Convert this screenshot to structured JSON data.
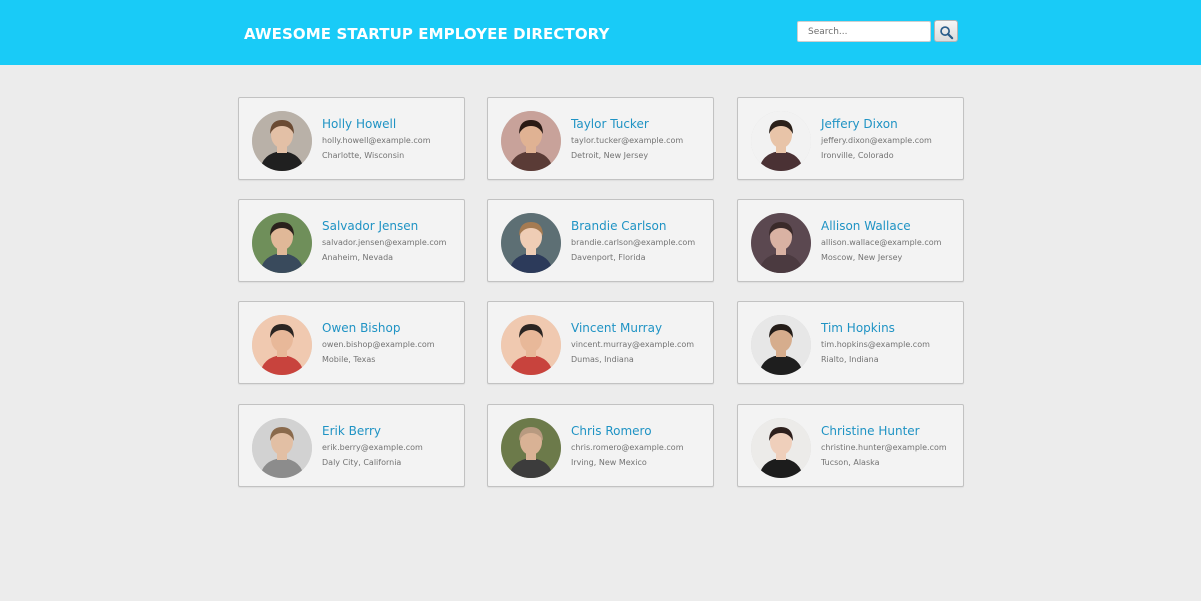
{
  "header": {
    "title": "AWESOME STARTUP EMPLOYEE DIRECTORY",
    "search_placeholder": "Search...",
    "search_button_icon": "search-icon",
    "background_color": "#19cbf7"
  },
  "employees": [
    {
      "name": "Holly Howell",
      "email": "holly.howell@example.com",
      "location": "Charlotte, Wisconsin",
      "photo": {
        "bg": "#b9b1a8",
        "skin": "#e3c0a6",
        "hair": "#6b4b33",
        "shirt": "#202020"
      }
    },
    {
      "name": "Taylor Tucker",
      "email": "taylor.tucker@example.com",
      "location": "Detroit, New Jersey",
      "photo": {
        "bg": "#c8a29a",
        "skin": "#e0b293",
        "hair": "#2a1a14",
        "shirt": "#5a3b36"
      }
    },
    {
      "name": "Jeffery Dixon",
      "email": "jeffery.dixon@example.com",
      "location": "Ironville, Colorado",
      "photo": {
        "bg": "#f2f2f2",
        "skin": "#e8c4a8",
        "hair": "#2b2019",
        "shirt": "#4a3134"
      }
    },
    {
      "name": "Salvador Jensen",
      "email": "salvador.jensen@example.com",
      "location": "Anaheim, Nevada",
      "photo": {
        "bg": "#6f8f5a",
        "skin": "#e0b898",
        "hair": "#2a211c",
        "shirt": "#394a5c"
      }
    },
    {
      "name": "Brandie Carlson",
      "email": "brandie.carlson@example.com",
      "location": "Davenport, Florida",
      "photo": {
        "bg": "#5d6f74",
        "skin": "#efcdb5",
        "hair": "#a57b52",
        "shirt": "#2c3a5a"
      }
    },
    {
      "name": "Allison Wallace",
      "email": "allison.wallace@example.com",
      "location": "Moscow, New Jersey",
      "photo": {
        "bg": "#5b4850",
        "skin": "#d9b2a3",
        "hair": "#3a2a2a",
        "shirt": "#4b3a40"
      }
    },
    {
      "name": "Owen Bishop",
      "email": "owen.bishop@example.com",
      "location": "Mobile, Texas",
      "photo": {
        "bg": "#f0c9b0",
        "skin": "#e8b899",
        "hair": "#2b2522",
        "shirt": "#c8433d"
      }
    },
    {
      "name": "Vincent Murray",
      "email": "vincent.murray@example.com",
      "location": "Dumas, Indiana",
      "photo": {
        "bg": "#f0c9b0",
        "skin": "#e8b899",
        "hair": "#2b2522",
        "shirt": "#c8433d"
      }
    },
    {
      "name": "Tim Hopkins",
      "email": "tim.hopkins@example.com",
      "location": "Rialto, Indiana",
      "photo": {
        "bg": "#e7e7e7",
        "skin": "#d6ad8d",
        "hair": "#231c18",
        "shirt": "#1e1e1e"
      }
    },
    {
      "name": "Erik Berry",
      "email": "erik.berry@example.com",
      "location": "Daly City, California",
      "photo": {
        "bg": "#d2d2d2",
        "skin": "#e2bfa4",
        "hair": "#8a6a4c",
        "shirt": "#8c8c8c"
      }
    },
    {
      "name": "Chris Romero",
      "email": "chris.romero@example.com",
      "location": "Irving, New Mexico",
      "photo": {
        "bg": "#6c7a4a",
        "skin": "#d9b295",
        "hair": "#b89a80",
        "shirt": "#3c3c3c"
      }
    },
    {
      "name": "Christine Hunter",
      "email": "christine.hunter@example.com",
      "location": "Tucson, Alaska",
      "photo": {
        "bg": "#ecebe9",
        "skin": "#efcfbb",
        "hair": "#2d1f1c",
        "shirt": "#1c1c1c"
      }
    }
  ]
}
